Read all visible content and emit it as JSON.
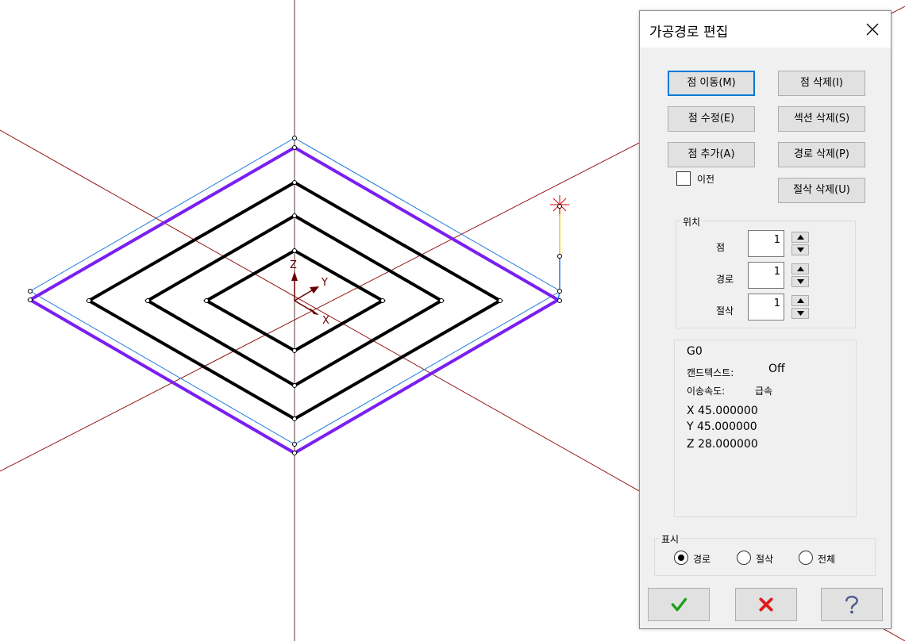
{
  "colors": {
    "axis_red": "#8b0000",
    "outer_path": "#7a1ff0",
    "offset_path": "#1e7be0",
    "tool_path": "#000000",
    "focus": "#0078d7"
  },
  "viewport": {
    "axis_labels": {
      "z": "Z",
      "y": "Y",
      "x": "X"
    }
  },
  "dialog": {
    "title": "가공경로 편집",
    "close_icon": "close-x-icon",
    "buttons": {
      "move_point": "점 이동(M)",
      "delete_point": "점 삭제(I)",
      "edit_point": "점 수정(E)",
      "delete_section": "섹션 삭제(S)",
      "add_point": "점 추가(A)",
      "delete_path": "경로 삭제(P)",
      "delete_cut": "절삭 삭제(U)"
    },
    "previous_checkbox": {
      "label": "이전",
      "checked": false
    },
    "position": {
      "title": "위치",
      "point": {
        "label": "점",
        "value": "1"
      },
      "path": {
        "label": "경로",
        "value": "1"
      },
      "cut": {
        "label": "절삭",
        "value": "1"
      }
    },
    "info": {
      "code": "G0",
      "cancel_text_label": "캔드텍스트:",
      "cancel_text_value": "Off",
      "feed_label": "이송속도:",
      "feed_value": "급속",
      "x": "X 45.000000",
      "y": "Y 45.000000",
      "z": "Z 28.000000"
    },
    "display": {
      "title": "표시",
      "options": [
        "경로",
        "절삭",
        "전체"
      ],
      "selected": "경로"
    },
    "bottom_buttons": {
      "ok_icon": "check-icon",
      "cancel_icon": "red-x-icon",
      "help_icon": "question-icon"
    }
  }
}
